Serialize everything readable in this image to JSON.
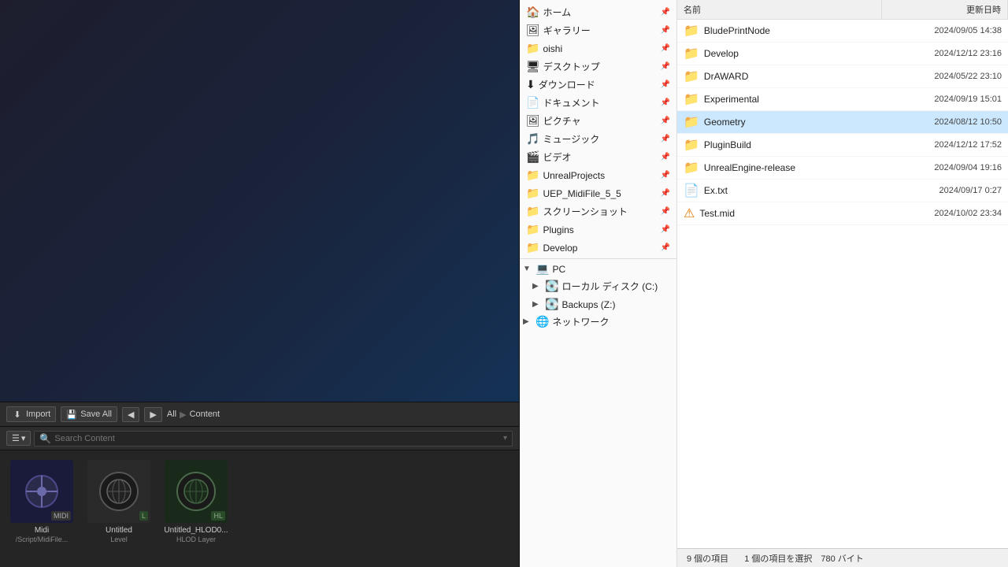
{
  "leftPanel": {
    "toolbar": {
      "importLabel": "Import",
      "saveAllLabel": "Save All",
      "backLabel": "◀",
      "forwardLabel": "▶",
      "pathItems": [
        "All",
        "▶",
        "Content"
      ],
      "settingsLabel": "⚙"
    },
    "searchBar": {
      "filterLabel": "☰",
      "filterArrow": "▾",
      "searchPlaceholder": "Search Content",
      "expandLabel": "▾"
    },
    "contentItems": [
      {
        "id": "midi",
        "type": "midi",
        "label": "Midi",
        "sublabel": "/Script/MidiFile..."
      },
      {
        "id": "untitled-level",
        "type": "level",
        "label": "Untitled",
        "sublabel": "Level"
      },
      {
        "id": "untitled-hlod",
        "type": "hlod",
        "label": "Untitled_HLOD0...",
        "sublabel": "HLOD Layer"
      }
    ]
  },
  "rightPanel": {
    "header": {
      "colName": "名前",
      "colDate": "更新日時"
    },
    "treeItems": [
      {
        "id": "home",
        "label": "ホーム",
        "icon": "🏠",
        "indent": 0,
        "hasPin": true
      },
      {
        "id": "gallery",
        "label": "ギャラリー",
        "icon": "🖼",
        "indent": 0,
        "hasPin": true
      },
      {
        "id": "oishi",
        "label": "oishi",
        "icon": "📁",
        "indent": 0,
        "hasPin": true
      },
      {
        "id": "desktop",
        "label": "デスクトップ",
        "icon": "🖥",
        "indent": 0,
        "hasPin": true
      },
      {
        "id": "downloads",
        "label": "ダウンロード",
        "icon": "⬇",
        "indent": 0,
        "hasPin": true
      },
      {
        "id": "documents",
        "label": "ドキュメント",
        "icon": "📄",
        "indent": 0,
        "hasPin": true
      },
      {
        "id": "pictures",
        "label": "ピクチャ",
        "icon": "🖼",
        "indent": 0,
        "hasPin": true
      },
      {
        "id": "music",
        "label": "ミュージック",
        "icon": "🎵",
        "indent": 0,
        "hasPin": true
      },
      {
        "id": "videos",
        "label": "ビデオ",
        "icon": "🎬",
        "indent": 0,
        "hasPin": true
      },
      {
        "id": "unreal-projects",
        "label": "UnrealProjects",
        "icon": "📁",
        "indent": 0,
        "hasPin": true
      },
      {
        "id": "uep-midi",
        "label": "UEP_MidiFile_5_5",
        "icon": "📁",
        "indent": 0,
        "hasPin": true
      },
      {
        "id": "screenshots",
        "label": "スクリーンショット",
        "icon": "📁",
        "indent": 0,
        "hasPin": true
      },
      {
        "id": "plugins",
        "label": "Plugins",
        "icon": "📁",
        "indent": 0,
        "hasPin": true
      },
      {
        "id": "develop",
        "label": "Develop",
        "icon": "📁",
        "indent": 0,
        "hasPin": true
      }
    ],
    "pcSection": {
      "label": "PC",
      "icon": "💻",
      "children": [
        {
          "id": "local-c",
          "label": "ローカル ディスク (C:)",
          "icon": "💽",
          "indent": 1
        },
        {
          "id": "backups-z",
          "label": "Backups (Z:)",
          "icon": "💽",
          "indent": 1
        }
      ]
    },
    "networkSection": {
      "label": "ネットワーク",
      "icon": "🌐"
    },
    "fileRows": [
      {
        "id": "blueprintnode",
        "name": "BludePrintNode",
        "icon": "folder",
        "date": "2024/09/05 14:38"
      },
      {
        "id": "develop",
        "name": "Develop",
        "icon": "folder",
        "date": "2024/12/12 23:16"
      },
      {
        "id": "draward",
        "name": "DrAWARD",
        "icon": "folder",
        "date": "2024/05/22 23:10"
      },
      {
        "id": "experimental",
        "name": "Experimental",
        "icon": "folder",
        "date": "2024/09/19 15:01"
      },
      {
        "id": "geometry",
        "name": "Geometry",
        "icon": "folder",
        "date": "2024/08/12 10:50",
        "selected": true
      },
      {
        "id": "pluginbuild",
        "name": "PluginBuild",
        "icon": "folder",
        "date": "2024/12/12 17:52"
      },
      {
        "id": "unrealengine-release",
        "name": "UnrealEngine-release",
        "icon": "folder",
        "date": "2024/09/04 19:16"
      },
      {
        "id": "ex-txt",
        "name": "Ex.txt",
        "icon": "txt",
        "date": "2024/09/17 0:27"
      },
      {
        "id": "test-mid",
        "name": "Test.mid",
        "icon": "mid",
        "date": "2024/10/02 23:34"
      }
    ],
    "statusBar": {
      "itemCount": "9 個の項目",
      "selectedInfo": "1 個の項目を選択　780 バイト"
    }
  }
}
